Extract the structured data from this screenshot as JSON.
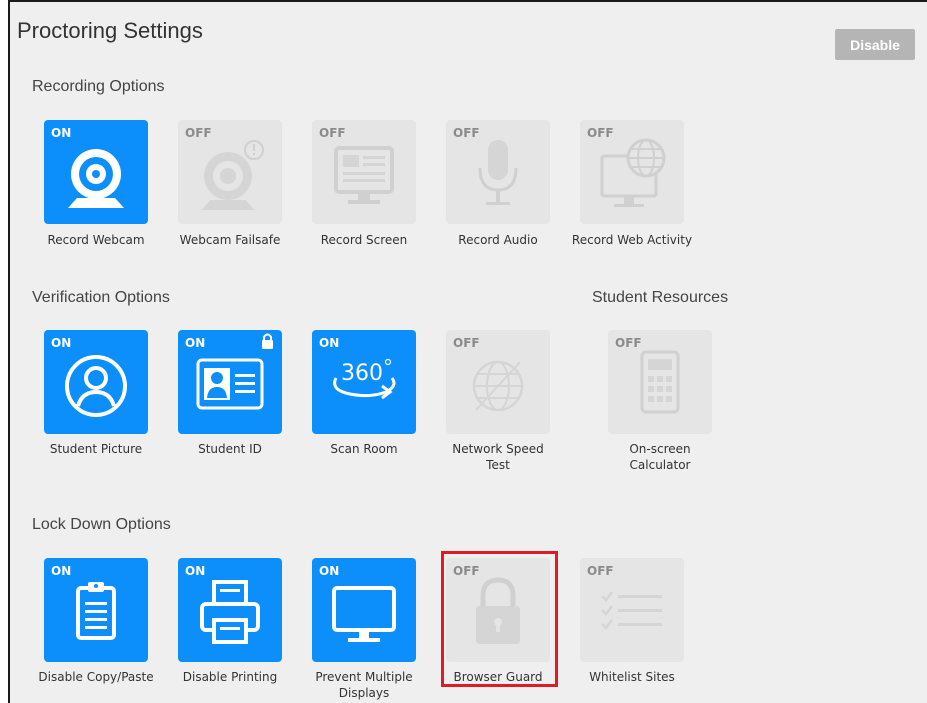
{
  "title": "Proctoring Settings",
  "disable_button": "Disable",
  "sections": {
    "recording": "Recording Options",
    "verification": "Verification Options",
    "resources": "Student Resources",
    "lockdown": "Lock Down Options"
  },
  "tiles": {
    "record_webcam": {
      "state": "ON",
      "label": "Record Webcam"
    },
    "webcam_failsafe": {
      "state": "OFF",
      "label": "Webcam Failsafe"
    },
    "record_screen": {
      "state": "OFF",
      "label": "Record Screen"
    },
    "record_audio": {
      "state": "OFF",
      "label": "Record Audio"
    },
    "record_web_activity": {
      "state": "OFF",
      "label": "Record Web Activity"
    },
    "student_picture": {
      "state": "ON",
      "label": "Student Picture"
    },
    "student_id": {
      "state": "ON",
      "label": "Student ID"
    },
    "scan_room": {
      "state": "ON",
      "label": "Scan Room",
      "icon_text": "360"
    },
    "network_speed": {
      "state": "OFF",
      "label_line1": "Network Speed",
      "label_line2": "Test"
    },
    "calculator": {
      "state": "OFF",
      "label_line1": "On-screen",
      "label_line2": "Calculator"
    },
    "copy_paste": {
      "state": "ON",
      "label": "Disable Copy/Paste"
    },
    "printing": {
      "state": "ON",
      "label": "Disable Printing"
    },
    "multiple_displays": {
      "state": "ON",
      "label_line1": "Prevent Multiple",
      "label_line2": "Displays"
    },
    "browser_guard": {
      "state": "OFF",
      "label": "Browser Guard"
    },
    "whitelist": {
      "state": "OFF",
      "label": "Whitelist Sites"
    }
  },
  "colors": {
    "on_tile": "#0d8ffb",
    "off_tile": "#e5e5e5",
    "highlight": "#e01b24",
    "background": "#efefef"
  }
}
